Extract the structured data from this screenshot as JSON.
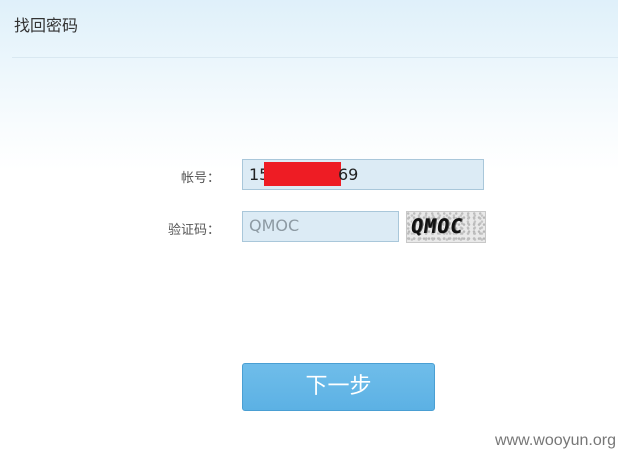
{
  "header": {
    "title": "找回密码"
  },
  "form": {
    "account_label": "帐号：",
    "account_value_prefix": "15",
    "account_value_suffix": "69",
    "captcha_label": "验证码：",
    "captcha_value": "QMOC",
    "captcha_image_text": "QMOC",
    "redaction_color": "#ee1c24"
  },
  "actions": {
    "next_label": "下一步"
  },
  "watermark": "www.wooyun.org"
}
